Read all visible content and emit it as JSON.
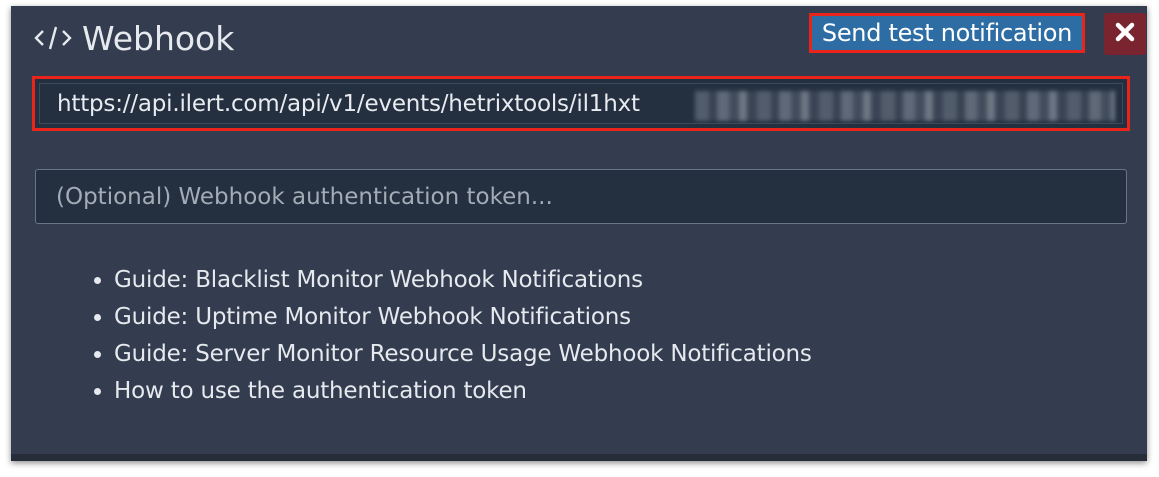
{
  "panel": {
    "title": "Webhook",
    "title_icon": "code-icon",
    "test_button_label": "Send test notification",
    "close_icon": "close-icon"
  },
  "url_field": {
    "value": "https://api.ilert.com/api/v1/events/hetrixtools/il1hxt"
  },
  "token_field": {
    "placeholder": "(Optional) Webhook authentication token..."
  },
  "guides": [
    "Guide: Blacklist Monitor Webhook Notifications",
    "Guide: Uptime Monitor Webhook Notifications",
    "Guide: Server Monitor Resource Usage Webhook Notifications",
    "How to use the authentication token"
  ],
  "colors": {
    "panel_bg": "#333d4f",
    "highlight": "#e8241b",
    "button_bg": "#2d6da3",
    "close_bg": "#7a2430"
  }
}
